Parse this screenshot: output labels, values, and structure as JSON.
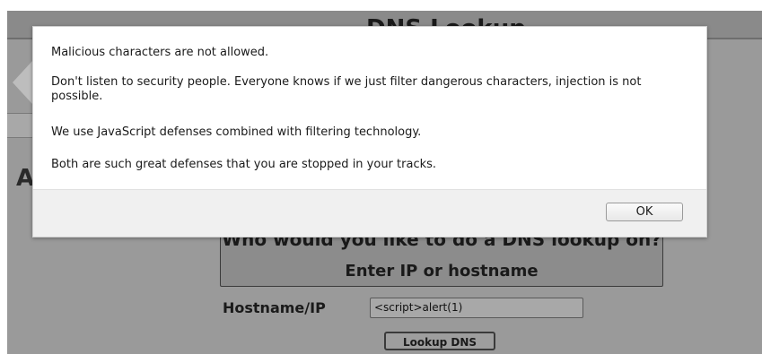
{
  "background_page": {
    "header_title": "DNS Lookup",
    "side_letter": "A",
    "question": "Who would you like to do a DNS lookup on?",
    "enter_label": "Enter IP or hostname",
    "hostname_label": "Hostname/IP",
    "hostname_value": "<script>alert(1)",
    "lookup_button": "Lookup DNS"
  },
  "dialog": {
    "messages": [
      "Malicious characters are not allowed.",
      "Don't listen to security people. Everyone knows if we just filter dangerous characters, injection is not possible.",
      "We use JavaScript defenses combined with filtering technology.",
      "Both are such great defenses that you are stopped in your tracks."
    ],
    "ok_button": "OK"
  }
}
